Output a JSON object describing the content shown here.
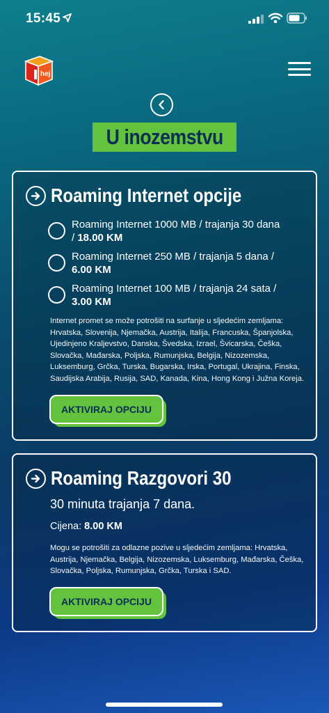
{
  "status_bar": {
    "time": "15:45"
  },
  "header": {
    "logo_text": "hej"
  },
  "page": {
    "title": "U inozemstvu"
  },
  "internet_card": {
    "title": "Roaming Internet opcije",
    "options": [
      {
        "text": "Roaming Internet 1000 MB / trajanja 30 dana / ",
        "price": "18.00 KM"
      },
      {
        "text": "Roaming Internet 250 MB / trajanja 5 dana / ",
        "price": "6.00 KM"
      },
      {
        "text": "Roaming Internet 100 MB / trajanja 24 sata / ",
        "price": "3.00 KM"
      }
    ],
    "description": "Internet promet se može potrošiti na surfanje u sljedećim zemljama: Hrvatska, Slovenija, Njemačka, Austrija, Italija, Francuska, Španjolska, Ujedinjeno Kraljevstvo, Danska, Švedska, Izrael, Švicarska, Češka, Slovačka, Mađarska, Poljska, Rumunjska, Belgija, Nizozemska, Luksemburg, Grčka, Turska, Bugarska, Irska, Portugal, Ukrajina, Finska, Saudijska Arabija, Rusija, SAD, Kanada, Kina, Hong Kong i Južna Koreja.",
    "button_label": "AKTIVIRAJ OPCIJU"
  },
  "calls_card": {
    "title": "Roaming Razgovori 30",
    "duration": "30 minuta trajanja 7 dana.",
    "price_label": "Cijena: ",
    "price_value": "8.00 KM",
    "description": "Mogu se potrošiti za odlazne pozive u sljedećim zemljama: Hrvatska, Austrija, Njemačka, Belgija, Nizozemska, Luksemburg, Mađarska, Češka, Slovačka, Poljska, Rumunjska, Grčka, Turska i SAD.",
    "button_label": "AKTIVIRAJ OPCIJU"
  },
  "icons": {
    "logo": "hej-logo-icon",
    "menu": "hamburger-menu-icon",
    "back": "chevron-left-circle-icon",
    "heading": "arrow-right-circle-icon",
    "radio": "radio-unchecked-icon"
  },
  "colors": {
    "accent_green": "#63c33f",
    "title_text": "#0b2e55",
    "logo_orange": "#f05a1e",
    "logo_red": "#d9261c"
  }
}
